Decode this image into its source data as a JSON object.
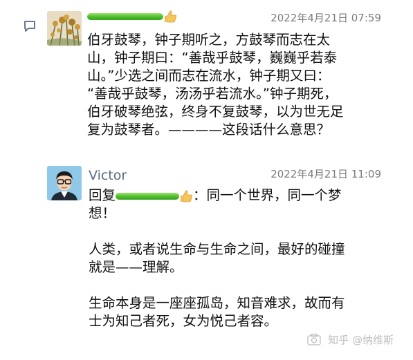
{
  "post": {
    "author_name": "",
    "timestamp": "2022年4月21日 07:59",
    "content_lines": [
      "伯牙鼓琴，钟子期听之，方鼓琴而志在太",
      "山，钟子期曰：“善哉乎鼓琴，巍巍乎若泰",
      "山。”少选之间而志在流水，钟子期又曰：",
      "“善哉乎鼓琴，汤汤乎若流水。”钟子期死，",
      "伯牙破琴绝弦，终身不复鼓琴，以为世无足",
      "复为鼓琴者。————这段话什么意思？"
    ]
  },
  "reply": {
    "author_name": "Victor",
    "timestamp": "2022年4月21日 11:09",
    "reply_prefix": "回复",
    "reply_suffix": "：同一个世界，同一个梦",
    "line2": "想！",
    "para2_line1": "人类，或者说生命与生命之间，最好的碰撞",
    "para2_line2": "就是——理解。",
    "para3_line1": "生命本身是一座座孤岛，知音难求，故而有",
    "para3_line2": "士为知己者死，女为悦己者容。"
  },
  "watermark": "知乎 @纳维斯",
  "icons": {
    "comment": "comment-icon",
    "thumb": "thumbs-up-icon",
    "avatar1": "flower-painting-avatar",
    "avatar2": "glasses-man-avatar"
  },
  "colors": {
    "name_highlight": "#48b82a",
    "author_name": "#5a6b84",
    "timestamp": "#7c7c7c"
  }
}
